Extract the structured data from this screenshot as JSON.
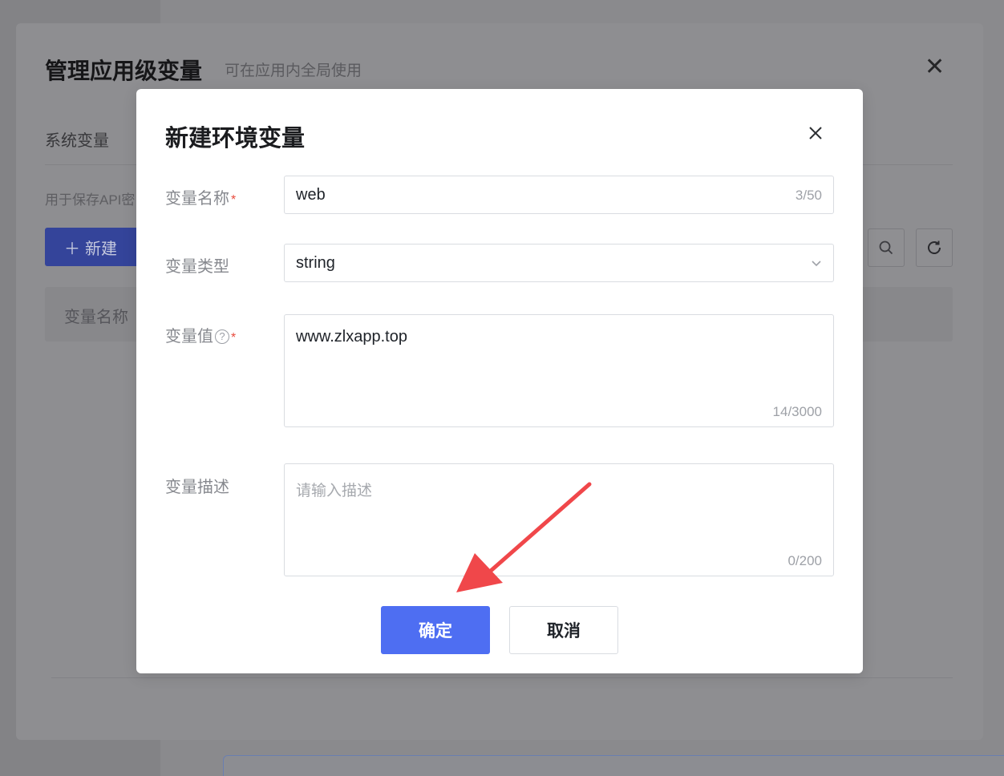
{
  "background": {
    "modal_title": "管理应用级变量",
    "modal_subtitle": "可在应用内全局使用",
    "tab_system": "系统变量",
    "description": "用于保存API密",
    "new_button": "新建",
    "column_name": "变量名称"
  },
  "dialog": {
    "title": "新建环境变量",
    "fields": {
      "name": {
        "label": "变量名称",
        "value": "web",
        "counter": "3/50",
        "required": "*"
      },
      "type": {
        "label": "变量类型",
        "value": "string"
      },
      "value": {
        "label": "变量值",
        "value": "www.zlxapp.top",
        "counter": "14/3000",
        "required": "*"
      },
      "description": {
        "label": "变量描述",
        "placeholder": "请输入描述",
        "counter": "0/200"
      }
    },
    "confirm_label": "确定",
    "cancel_label": "取消"
  },
  "annotation": {
    "arrow_color": "#f0474a"
  },
  "colors": {
    "primary": "#4e6ef2",
    "required": "#e84b3d"
  }
}
